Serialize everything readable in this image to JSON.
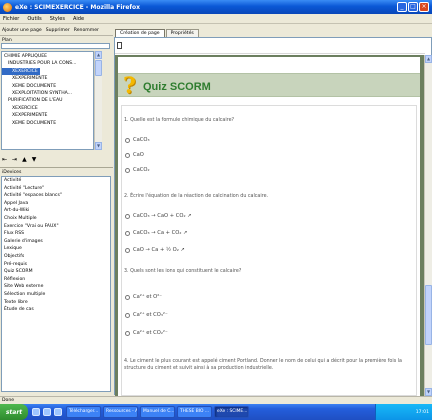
{
  "window": {
    "title": "eXe : SCIMEXERCICE - Mozilla Firefox"
  },
  "menu": [
    "Fichier",
    "Outils",
    "Styles",
    "Aide"
  ],
  "toolbar": {
    "add_page": "Ajouter une page",
    "delete": "Supprimer",
    "rename": "Renommer"
  },
  "left": {
    "filter_label": "Plan",
    "tree": [
      {
        "label": "CHIMIE APPLIQUEE",
        "indent": 0,
        "selected": false
      },
      {
        "label": "INDUSTRIES POUR LA CONS...",
        "indent": 1,
        "selected": false
      },
      {
        "label": "XEXERCICE",
        "indent": 2,
        "selected": true
      },
      {
        "label": "XEXPERIMENTE",
        "indent": 2,
        "selected": false
      },
      {
        "label": "XEME DOCUMENTE",
        "indent": 2,
        "selected": false
      },
      {
        "label": "XEXPLOITATION SYNTHA...",
        "indent": 2,
        "selected": false
      },
      {
        "label": "PURIFICATION DE L'EAU",
        "indent": 1,
        "selected": false
      },
      {
        "label": "XEXERCICE",
        "indent": 2,
        "selected": false
      },
      {
        "label": "XEXPERIMENTE",
        "indent": 2,
        "selected": false
      },
      {
        "label": "XEME DOCUMENTE",
        "indent": 2,
        "selected": false
      }
    ],
    "devices_label": "iDevices",
    "devices": [
      "Activité",
      "Activité \"Lecture\"",
      "Activité \"espaces blancs\"",
      "Appel Java",
      "Art-du-Wiki",
      "Choix Multiple",
      "Exercice \"Vrai ou FAUX\"",
      "Flux RSS",
      "Galerie d'images",
      "Lexique",
      "Objectifs",
      "Pré-requis",
      "Quiz SCORM",
      "Réflexion",
      "Site Web externe",
      "Sélection multiple",
      "Texte libre",
      "Étude de cas"
    ]
  },
  "tabs": [
    {
      "label": "Création de page",
      "active": true
    },
    {
      "label": "Propriétés",
      "active": false
    }
  ],
  "quiz": {
    "title": "Quiz SCORM",
    "questions": [
      {
        "text": "1. Quelle est la formule chimique du calcaire?",
        "options": [
          "CaCO₃",
          "CaO",
          "CaCO₂"
        ]
      },
      {
        "text": "2. Écrire l'équation de la réaction de calcination du calcaire.",
        "options": [
          "CaCO₃ → CaO + CO₂ ↗",
          "CaCO₃ → Ca + CO₂ ↗",
          "CaO → Ca + ½ O₂ ↗"
        ]
      },
      {
        "text": "3. Quels sont les ions qui constituent le calcaire?",
        "options": [
          "Ca²⁺ et O²⁻",
          "Ca²⁺ et CO₃²⁻",
          "Ca²⁺ et CO₂²⁻"
        ]
      }
    ],
    "q4": "4. Le ciment le plus courant est appelé ciment Portland. Donner le nom de celui qui a décrit pour la première fois la structure du ciment et suivit ainsi à sa production industrielle."
  },
  "status": "Done",
  "taskbar": {
    "start": "start",
    "tasks": [
      {
        "label": "Télécharger...",
        "active": false
      },
      {
        "label": "Ressources - A...",
        "active": false
      },
      {
        "label": "Manuel de C...",
        "active": false
      },
      {
        "label": "THESE BIO ...",
        "active": false
      },
      {
        "label": "eXe : SCIME...",
        "active": true
      }
    ],
    "time": "17:01"
  },
  "colors": {
    "accent": "#316ac5",
    "quiz_green": "#2f7d2f",
    "canvas_bg": "#6c7f5f"
  }
}
